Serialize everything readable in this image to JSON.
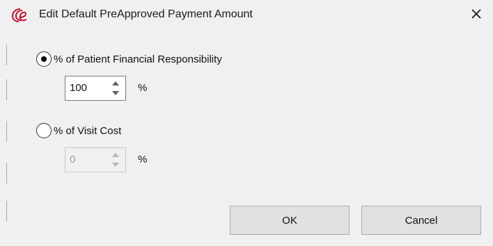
{
  "window": {
    "title": "Edit Default PreApproved Payment Amount",
    "icon": "app-logo-icon",
    "close_icon": "close-icon"
  },
  "options": {
    "patient_responsibility": {
      "label": "% of Patient Financial Responsibility",
      "selected": true,
      "value": "100",
      "unit": "%"
    },
    "visit_cost": {
      "label": "% of Visit Cost",
      "selected": false,
      "value": "0",
      "unit": "%",
      "disabled": true
    }
  },
  "buttons": {
    "ok": "OK",
    "cancel": "Cancel"
  },
  "colors": {
    "dialog_bg": "#f0f0f0",
    "logo_red": "#c8102e"
  }
}
